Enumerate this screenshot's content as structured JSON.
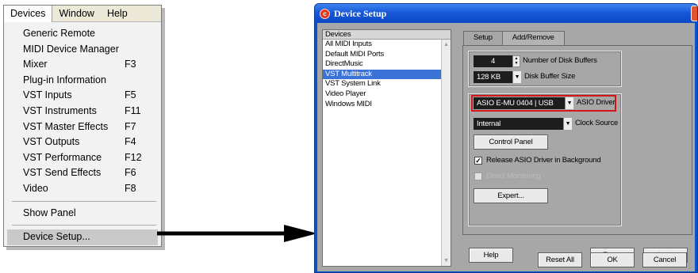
{
  "menu": {
    "bar": [
      "Devices",
      "Window",
      "Help"
    ],
    "items": [
      {
        "label": "Generic Remote",
        "shortcut": ""
      },
      {
        "label": "MIDI Device Manager",
        "shortcut": ""
      },
      {
        "label": "Mixer",
        "shortcut": "F3"
      },
      {
        "label": "Plug-in Information",
        "shortcut": ""
      },
      {
        "label": "VST Inputs",
        "shortcut": "F5"
      },
      {
        "label": "VST Instruments",
        "shortcut": "F11"
      },
      {
        "label": "VST Master Effects",
        "shortcut": "F7"
      },
      {
        "label": "VST Outputs",
        "shortcut": "F4"
      },
      {
        "label": "VST Performance",
        "shortcut": "F12"
      },
      {
        "label": "VST Send Effects",
        "shortcut": "F6"
      },
      {
        "label": "Video",
        "shortcut": "F8"
      }
    ],
    "show_panel": "Show Panel",
    "device_setup": "Device Setup..."
  },
  "dialog": {
    "title": "Device Setup",
    "devices_header": "Devices",
    "devices": [
      "All MIDI Inputs",
      "Default MIDI Ports",
      "DirectMusic",
      "VST Multitrack",
      "VST System Link",
      "Video Player",
      "Windows MIDI"
    ],
    "selected_device": "VST Multitrack",
    "tabs": [
      "Setup",
      "Add/Remove"
    ],
    "active_tab": "Setup",
    "disk_buffers_value": "4",
    "disk_buffers_label": "Number of Disk Buffers",
    "buffer_size_value": "128 KB",
    "buffer_size_label": "Disk Buffer Size",
    "asio_driver_value": "ASIO E-MU 0404 | USB",
    "asio_driver_label": "ASIO Driver",
    "clock_source_value": "Internal",
    "clock_source_label": "Clock Source",
    "control_panel_button": "Control Panel",
    "release_asio_label": "Release ASIO Driver in Background",
    "release_asio_checked": true,
    "direct_monitoring_label": "Direct Monitoring",
    "expert_button": "Expert...",
    "help_button": "Help",
    "reset_button": "Reset",
    "apply_button": "Apply",
    "reset_all_button": "Reset All",
    "ok_button": "OK",
    "cancel_button": "Cancel",
    "highlight_color": "#d2161a",
    "selection_color": "#3a72d6"
  }
}
